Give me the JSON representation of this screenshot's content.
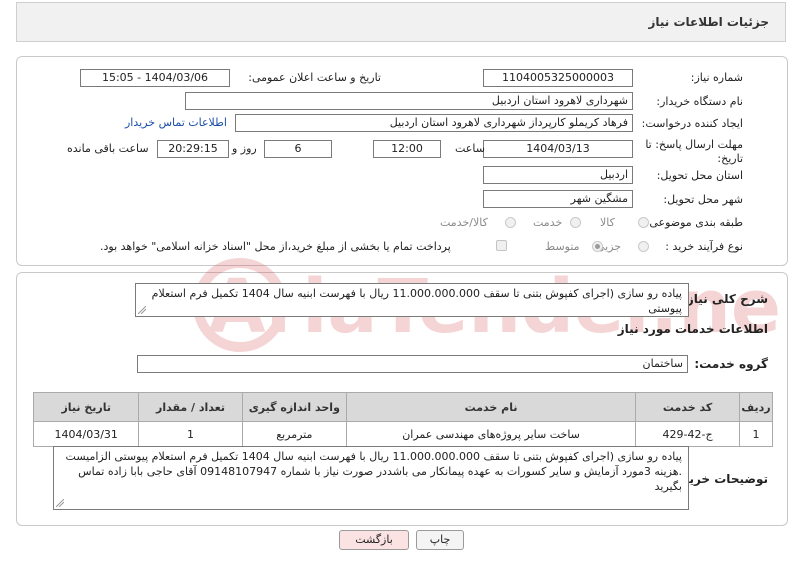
{
  "header": {
    "title": "جزئیات اطلاعات نیاز"
  },
  "form": {
    "need_number": {
      "label": "شماره نیاز:",
      "value": "1104005325000003"
    },
    "announce": {
      "label": "تاریخ و ساعت اعلان عمومی:",
      "value": "1404/03/06 - 15:05"
    },
    "buyer_org": {
      "label": "نام دستگاه خریدار:",
      "value": "شهرداری لاهرود استان اردبیل"
    },
    "requester": {
      "label": "ایجاد کننده درخواست:",
      "value": "فرهاد  کریملو کارپرداز  شهرداری لاهرود استان اردبیل",
      "contact_link": "اطلاعات تماس خریدار"
    },
    "deadline": {
      "label": "مهلت ارسال پاسخ: تا تاریخ:",
      "date": "1404/03/13",
      "time_label": "ساعت",
      "time": "12:00",
      "days": "6",
      "days_label": "روز و",
      "remaining": "20:29:15",
      "remaining_label": "ساعت باقی مانده"
    },
    "province": {
      "label": "استان محل تحویل:",
      "value": "اردبیل"
    },
    "city": {
      "label": "شهر محل تحویل:",
      "value": "مشگین شهر"
    },
    "category": {
      "label": "طبقه بندی موضوعی:",
      "options": [
        "کالا",
        "خدمت",
        "کالا/خدمت"
      ],
      "selected": ""
    },
    "process": {
      "label": "نوع فرآیند خرید :",
      "options": [
        "جزیی",
        "متوسط"
      ],
      "selected": "متوسط",
      "payment_note": "پرداخت تمام یا بخشی از مبلغ خرید،از محل \"اسناد خزانه اسلامی\" خواهد بود."
    }
  },
  "summary": {
    "label": "شرح کلی نیاز:",
    "text": "پیاده رو سازی (اجرای کفپوش بتنی تا سقف 11.000.000.000 ریال با فهرست ابنیه سال 1404 تکمیل فرم استعلام پیوستی"
  },
  "services": {
    "section_title": "اطلاعات خدمات مورد نیاز",
    "group_label": "گروه خدمت:",
    "group_value": "ساختمان",
    "columns": [
      "ردیف",
      "کد خدمت",
      "نام خدمت",
      "واحد اندازه گیری",
      "تعداد / مقدار",
      "تاریخ نیاز"
    ],
    "rows": [
      {
        "row": "1",
        "code": "ج-42-429",
        "name": "ساخت سایر پروژه‌های مهندسی عمران",
        "unit": "مترمربع",
        "qty": "1",
        "date": "1404/03/31"
      }
    ]
  },
  "buyer_notes": {
    "label": "توضیحات خریدار:",
    "text": "پیاده رو سازی (اجرای کفپوش بتنی تا سقف 11.000.000.000 ریال با فهرست ابنیه سال 1404 تکمیل فرم استعلام پیوستی الزامیست .هزینه 3مورد آزمایش و سایر کسورات به عهده پیمانکار می باشددر صورت نیاز با شماره 09148107947 آقای حاجی بابا زاده تماس بگیرید"
  },
  "buttons": {
    "print": "چاپ",
    "back": "بازگشت"
  },
  "watermark": {
    "text": "AriaTender.neT"
  },
  "colors": {
    "accent": "#1a4fa8",
    "watermark": "#d04040",
    "back_button_bg": "#fbe3e3"
  }
}
